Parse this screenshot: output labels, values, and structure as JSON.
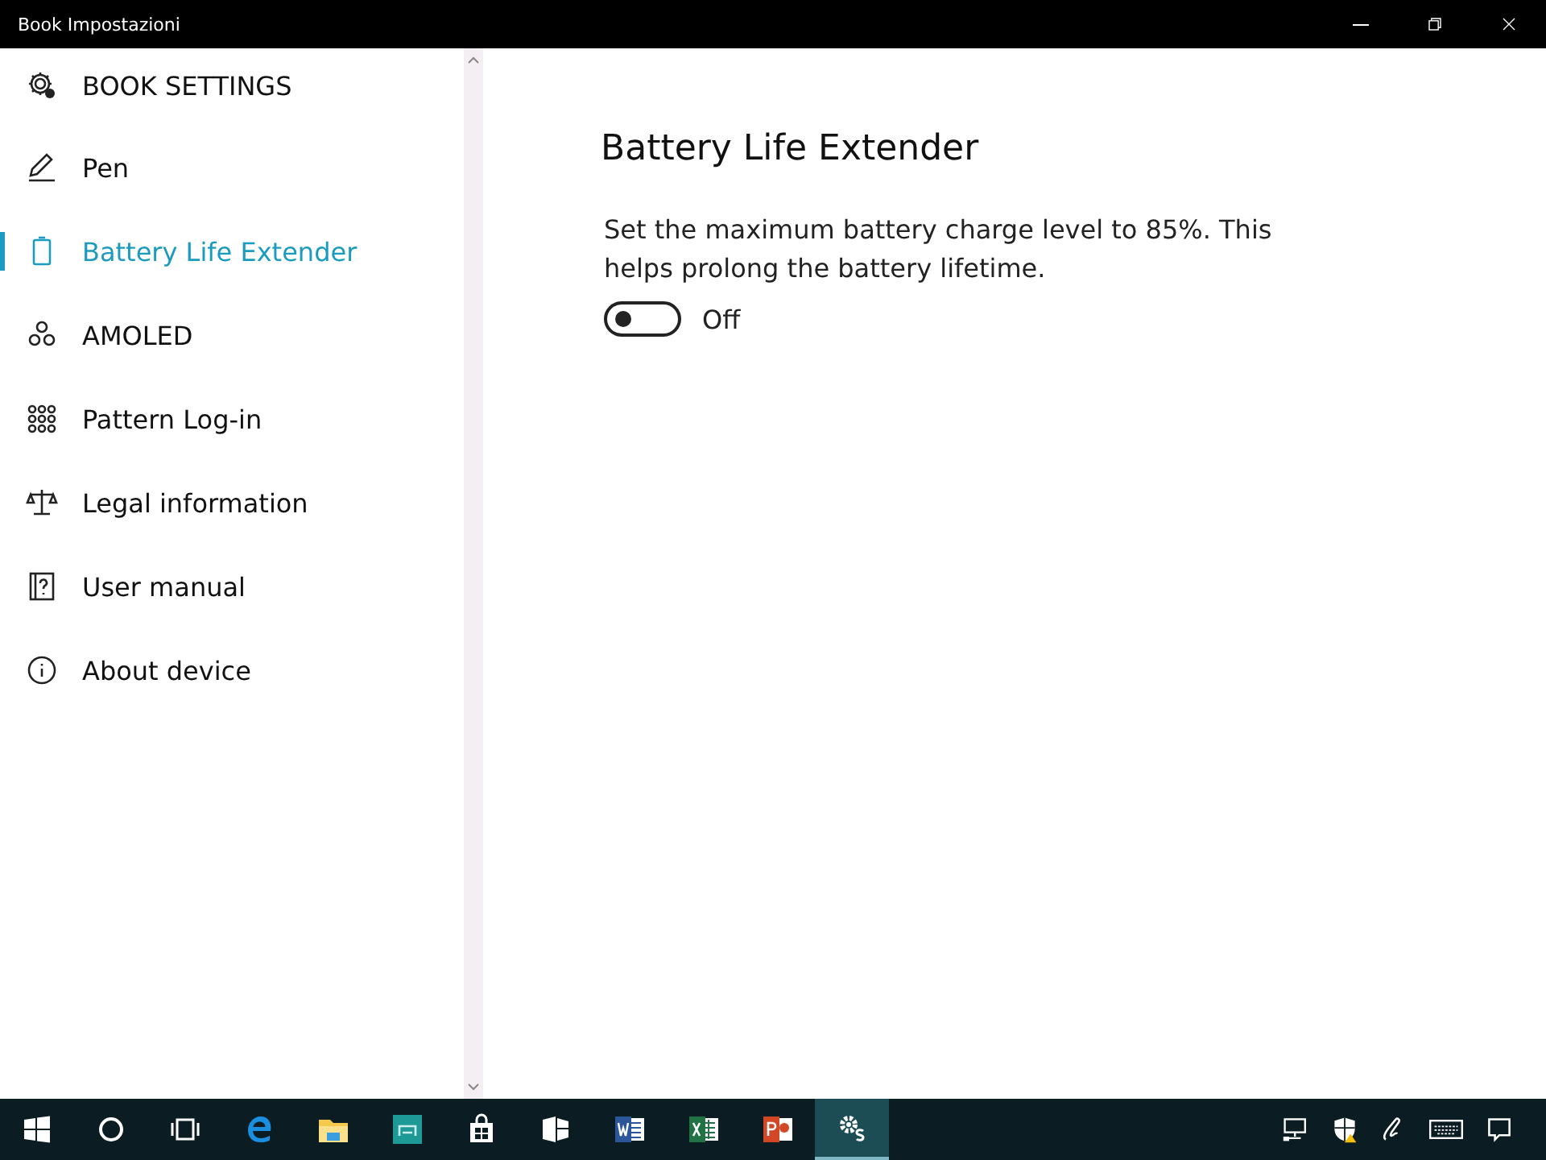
{
  "window": {
    "title": "Book Impostazioni"
  },
  "sidebar": {
    "header": "BOOK SETTINGS",
    "items": [
      {
        "label": "Pen",
        "kind": "pen",
        "selected": false
      },
      {
        "label": "Battery Life Extender",
        "kind": "battery",
        "selected": true
      },
      {
        "label": "AMOLED",
        "kind": "circles",
        "selected": false
      },
      {
        "label": "Pattern Log-in",
        "kind": "dots",
        "selected": false
      },
      {
        "label": "Legal information",
        "kind": "scale",
        "selected": false
      },
      {
        "label": "User manual",
        "kind": "help",
        "selected": false
      },
      {
        "label": "About device",
        "kind": "info",
        "selected": false
      }
    ]
  },
  "content": {
    "heading": "Battery Life Extender",
    "description": "Set the maximum battery charge level to 85%. This helps prolong the battery lifetime.",
    "toggle": {
      "on": false,
      "label": "Off"
    }
  },
  "taskbar": {
    "apps": [
      {
        "kind": "start",
        "selected": false
      },
      {
        "kind": "search",
        "selected": false
      },
      {
        "kind": "taskview",
        "selected": false
      },
      {
        "kind": "browser",
        "selected": false
      },
      {
        "kind": "folder",
        "selected": false
      },
      {
        "kind": "gallery",
        "selected": false
      },
      {
        "kind": "store",
        "selected": false
      },
      {
        "kind": "flag",
        "selected": false
      },
      {
        "kind": "word",
        "selected": false
      },
      {
        "kind": "excel",
        "selected": false
      },
      {
        "kind": "slides",
        "selected": false
      },
      {
        "kind": "gears",
        "selected": true
      }
    ],
    "tray": [
      {
        "kind": "network"
      },
      {
        "kind": "shield"
      },
      {
        "kind": "pen"
      },
      {
        "kind": "keyboard"
      },
      {
        "kind": "chat"
      }
    ]
  }
}
